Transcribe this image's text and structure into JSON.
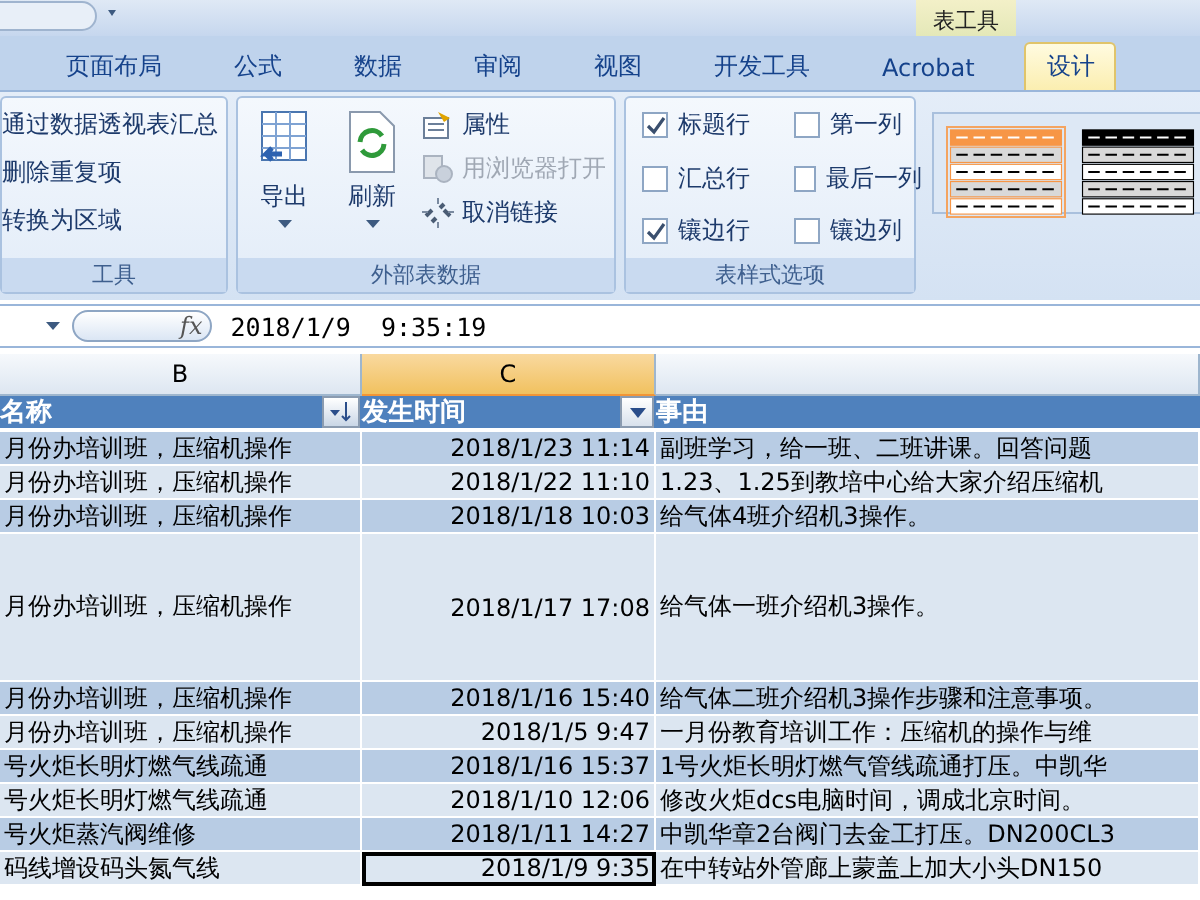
{
  "title_bar": {
    "context_label": "表工具"
  },
  "tabs": [
    {
      "label": "页面布局",
      "selected": false
    },
    {
      "label": "公式",
      "selected": false
    },
    {
      "label": "数据",
      "selected": false
    },
    {
      "label": "审阅",
      "selected": false
    },
    {
      "label": "视图",
      "selected": false
    },
    {
      "label": "开发工具",
      "selected": false
    },
    {
      "label": "Acrobat",
      "selected": false
    },
    {
      "label": "设计",
      "selected": true
    }
  ],
  "ribbon": {
    "tools": {
      "title": "工具",
      "commands": [
        "通过数据透视表汇总",
        "删除重复项",
        "转换为区域"
      ]
    },
    "external_data": {
      "title": "外部表数据",
      "large": [
        {
          "label": "导出",
          "kind": "export"
        },
        {
          "label": "刷新",
          "kind": "refresh"
        }
      ],
      "small": [
        {
          "label": "属性",
          "kind": "properties",
          "disabled": false
        },
        {
          "label": "用浏览器打开",
          "kind": "browser",
          "disabled": true
        },
        {
          "label": "取消链接",
          "kind": "unlink",
          "disabled": false
        }
      ]
    },
    "style_options": {
      "title": "表样式选项",
      "options": [
        {
          "label": "标题行",
          "checked": true
        },
        {
          "label": "第一列",
          "checked": false
        },
        {
          "label": "汇总行",
          "checked": false
        },
        {
          "label": "最后一列",
          "checked": false
        },
        {
          "label": "镶边行",
          "checked": true
        },
        {
          "label": "镶边列",
          "checked": false
        }
      ]
    },
    "styles": [
      {
        "color": "#f79646",
        "selected": true
      },
      {
        "color": "#000000",
        "selected": false
      }
    ]
  },
  "formula_bar": {
    "function_label": "fx",
    "value": "2018/1/9  9:35:19"
  },
  "sheet": {
    "columns": [
      {
        "label": "B",
        "selected": false
      },
      {
        "label": "C",
        "selected": true
      },
      {
        "selected": false
      }
    ],
    "headers": [
      {
        "label": "名称",
        "filter": true,
        "sorted": true
      },
      {
        "label": "发生时间",
        "filter": true,
        "sorted": false
      },
      {
        "label": "事由",
        "filter": false
      }
    ],
    "rows": [
      {
        "cells": [
          "月份办培训班，压缩机操作",
          "2018/1/23 11:14",
          "副班学习，给一班、二班讲课。回答问题"
        ],
        "tall": false,
        "selected": false
      },
      {
        "cells": [
          "月份办培训班，压缩机操作",
          "2018/1/22 11:10",
          "1.23、1.25到教培中心给大家介绍压缩机"
        ],
        "tall": false,
        "selected": false
      },
      {
        "cells": [
          "月份办培训班，压缩机操作",
          "2018/1/18 10:03",
          "给气体4班介绍机3操作。"
        ],
        "tall": false,
        "selected": false
      },
      {
        "cells": [
          "月份办培训班，压缩机操作",
          "2018/1/17 17:08",
          "给气体一班介绍机3操作。"
        ],
        "tall": true,
        "selected": false
      },
      {
        "cells": [
          "月份办培训班，压缩机操作",
          "2018/1/16 15:40",
          "给气体二班介绍机3操作步骤和注意事项。"
        ],
        "tall": false,
        "selected": false
      },
      {
        "cells": [
          "月份办培训班，压缩机操作",
          "2018/1/5 9:47",
          "一月份教育培训工作：压缩机的操作与维"
        ],
        "tall": false,
        "selected": false
      },
      {
        "cells": [
          "号火炬长明灯燃气线疏通",
          "2018/1/16 15:37",
          "1号火炬长明灯燃气管线疏通打压。中凯华"
        ],
        "tall": false,
        "selected": false
      },
      {
        "cells": [
          "号火炬长明灯燃气线疏通",
          "2018/1/10 12:06",
          "修改火炬dcs电脑时间，调成北京时间。"
        ],
        "tall": false,
        "selected": false
      },
      {
        "cells": [
          "号火炬蒸汽阀维修",
          "2018/1/11 14:27",
          "中凯华章2台阀门去金工打压。DN200CL3"
        ],
        "tall": false,
        "selected": false
      },
      {
        "cells": [
          "码线增设码头氮气线",
          "2018/1/9 9:35",
          "在中转站外管廊上蒙盖上加大小头DN150"
        ],
        "tall": false,
        "selected": true
      }
    ]
  }
}
